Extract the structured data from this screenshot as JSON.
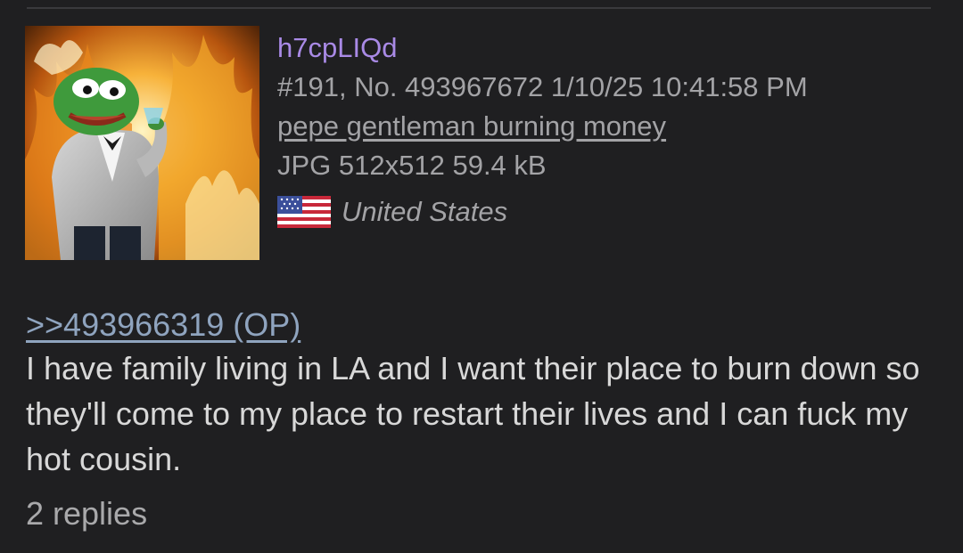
{
  "post": {
    "poster_id": "h7cpLIQd",
    "post_line": "#191, No. 493967672 1/10/25 10:41:58 PM",
    "file": {
      "name": "pepe gentleman burning money",
      "info": "JPG 512x512 59.4 kB",
      "thumbnail_icon": "pepe-gentleman-fire-image"
    },
    "country": {
      "name": "United States",
      "flag_icon": "us-flag-icon"
    },
    "quote_link": ">>493966319 (OP)",
    "comment": "I have family living in LA and I want their place to burn down so they'll come to my place to restart their lives and I can fuck my hot cousin.",
    "replies": "2 replies"
  },
  "colors": {
    "background": "#1f1f21",
    "poster_id": "#a98ae6",
    "meta_text": "#a3a3a6",
    "quote_link": "#8fa4bf",
    "body_text": "#d8d8d8"
  }
}
